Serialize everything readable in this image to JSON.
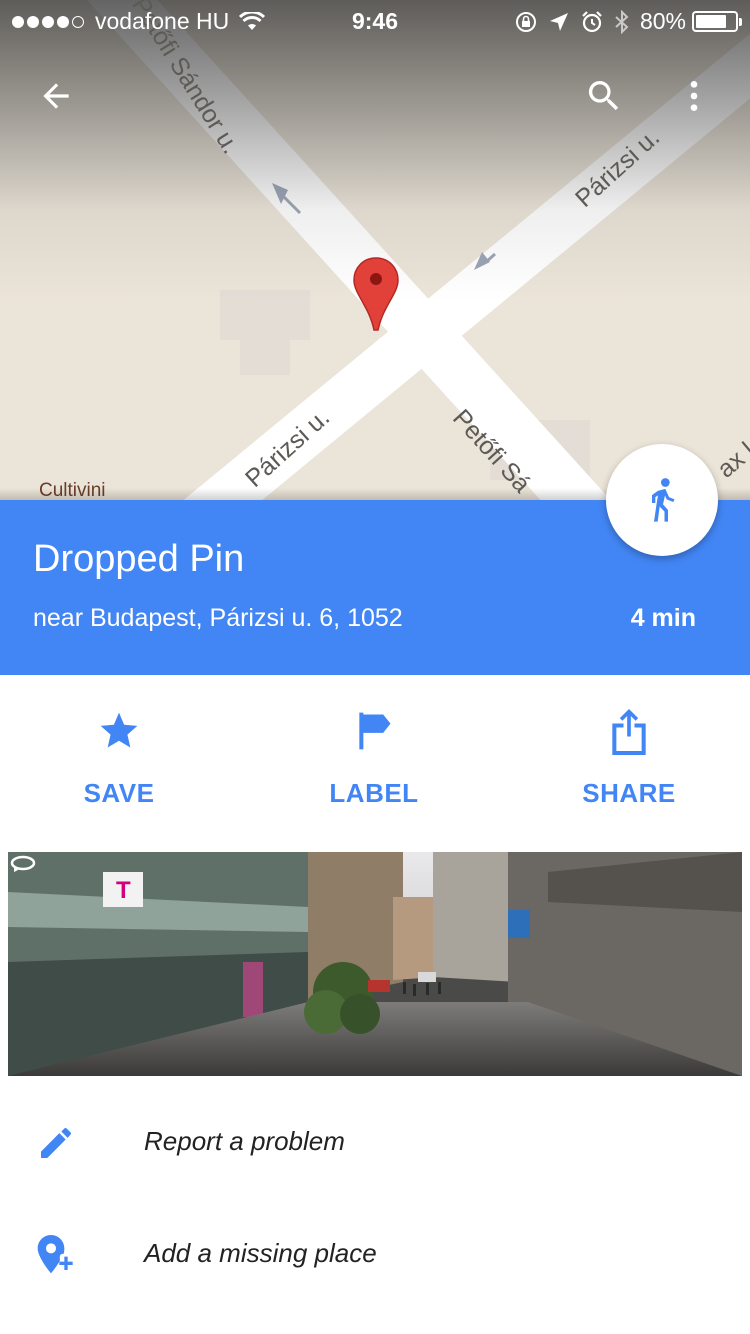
{
  "status_bar": {
    "carrier": "vodafone HU",
    "time": "9:46",
    "battery": "80%",
    "battery_level": 0.8,
    "signal_bars_filled": 4,
    "signal_bars_total": 5
  },
  "map": {
    "streets": [
      "Petőfi Sándor u.",
      "Párizsi u.",
      "Párizsi u.",
      "Petőfi Sá",
      "ax kö"
    ],
    "poi": "Cultivini",
    "pin_color": "#e2413a"
  },
  "place": {
    "title": "Dropped Pin",
    "address": "near Budapest, Párizsi u. 6, 1052",
    "eta": "4 min",
    "accent": "#4286f5"
  },
  "actions": [
    {
      "label": "SAVE",
      "icon": "star-icon"
    },
    {
      "label": "LABEL",
      "icon": "flag-icon"
    },
    {
      "label": "SHARE",
      "icon": "share-icon"
    }
  ],
  "list": [
    {
      "label": "Report a problem",
      "icon": "pencil-icon"
    },
    {
      "label": "Add a missing place",
      "icon": "add-place-icon"
    }
  ]
}
